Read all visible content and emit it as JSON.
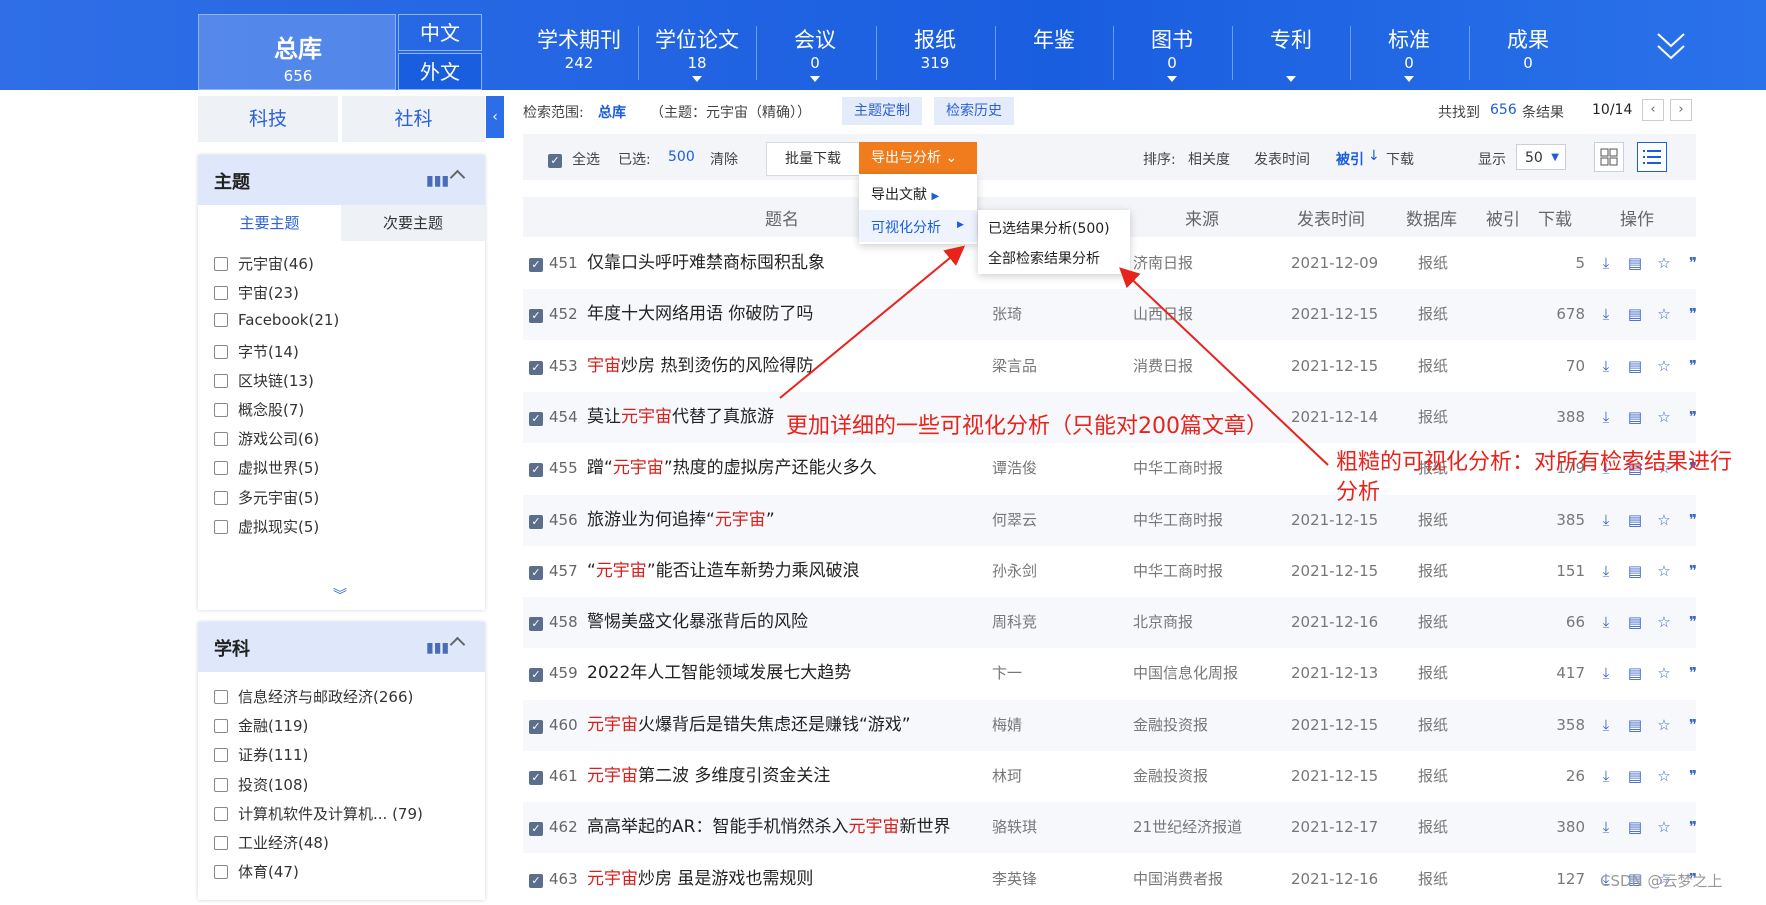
{
  "top_nav": {
    "all_title": "总库",
    "all_count": "656",
    "lang_cn": "中文",
    "lang_en": "外文",
    "items": [
      {
        "label": "学术期刊",
        "count": "242",
        "caret": false
      },
      {
        "label": "学位论文",
        "count": "18",
        "caret": true
      },
      {
        "label": "会议",
        "count": "0",
        "caret": true
      },
      {
        "label": "报纸",
        "count": "319",
        "caret": false
      },
      {
        "label": "年鉴",
        "count": "",
        "caret": false
      },
      {
        "label": "图书",
        "count": "0",
        "caret": true
      },
      {
        "label": "专利",
        "count": "",
        "caret": true
      },
      {
        "label": "标准",
        "count": "0",
        "caret": true
      },
      {
        "label": "成果",
        "count": "0",
        "caret": false
      }
    ]
  },
  "left": {
    "tabs": [
      "科技",
      "社科"
    ],
    "topic": {
      "title": "主题",
      "subtabs": [
        "主要主题",
        "次要主题"
      ],
      "items": [
        "元宇宙(46)",
        "宇宙(23)",
        "Facebook(21)",
        "字节(14)",
        "区块链(13)",
        "概念股(7)",
        "游戏公司(6)",
        "虚拟世界(5)",
        "多元宇宙(5)",
        "虚拟现实(5)"
      ]
    },
    "subject": {
      "title": "学科",
      "items": [
        "信息经济与邮政经济(266)",
        "金融(119)",
        "证券(111)",
        "投资(108)",
        "计算机软件及计算机...  (79)",
        "工业经济(48)",
        "体育(47)"
      ]
    }
  },
  "search": {
    "scope_label": "检索范围:",
    "scope_value": "总库",
    "query": "（主题：元宇宙（精确））",
    "btn_custom": "主题定制",
    "btn_history": "检索历史",
    "found_prefix": "共找到",
    "found_count": "656",
    "found_suffix": "条结果",
    "page": "10/14"
  },
  "toolbar": {
    "select_all": "全选",
    "selected_label": "已选:",
    "selected_count": "500",
    "clear": "清除",
    "batch_download": "批量下载",
    "export": "导出与分析",
    "sort_label": "排序:",
    "sort_relevance": "相关度",
    "sort_date": "发表时间",
    "sort_cited": "被引",
    "sort_download": "下载",
    "display_label": "显示",
    "display_value": "50"
  },
  "dropdown": {
    "export_docs": "导出文献",
    "visual_analysis": "可视化分析",
    "selected_analysis": "已选结果分析(500)",
    "all_analysis": "全部检索结果分析"
  },
  "table": {
    "headers": {
      "title": "题名",
      "author": "作者",
      "source": "来源",
      "date": "发表时间",
      "db": "数据库",
      "cited": "被引",
      "download": "下载",
      "ops": "操作"
    },
    "rows": [
      {
        "num": "451",
        "title": [
          {
            "t": "仅靠口头呼吁难禁商标囤积乱象",
            "h": false
          }
        ],
        "author": "",
        "source": "济南日报",
        "date": "2021-12-09",
        "db": "报纸",
        "downloads": "5"
      },
      {
        "num": "452",
        "title": [
          {
            "t": "年度十大网络用语 你破防了吗",
            "h": false
          }
        ],
        "author": "张琦",
        "source": "山西日报",
        "date": "2021-12-15",
        "db": "报纸",
        "downloads": "678"
      },
      {
        "num": "453",
        "title": [
          {
            "t": "宇宙",
            "h": true
          },
          {
            "t": "炒房 热到烫伤的风险得防",
            "h": false
          }
        ],
        "author": "梁言品",
        "source": "消费日报",
        "date": "2021-12-15",
        "db": "报纸",
        "downloads": "70"
      },
      {
        "num": "454",
        "title": [
          {
            "t": "莫让",
            "h": false
          },
          {
            "t": "元宇宙",
            "h": true
          },
          {
            "t": "代替了真旅游",
            "h": false
          }
        ],
        "author": "",
        "source": "",
        "date": "2021-12-14",
        "db": "报纸",
        "downloads": "388"
      },
      {
        "num": "455",
        "title": [
          {
            "t": "蹭“",
            "h": false
          },
          {
            "t": "元宇宙",
            "h": true
          },
          {
            "t": "”热度的虚拟房产还能火多久",
            "h": false
          }
        ],
        "author": "谭浩俊",
        "source": "中华工商时报",
        "date": "",
        "db": "报纸",
        "downloads": "179"
      },
      {
        "num": "456",
        "title": [
          {
            "t": "旅游业为何追捧“",
            "h": false
          },
          {
            "t": "元宇宙",
            "h": true
          },
          {
            "t": "”",
            "h": false
          }
        ],
        "author": "何翠云",
        "source": "中华工商时报",
        "date": "2021-12-15",
        "db": "报纸",
        "downloads": "385"
      },
      {
        "num": "457",
        "title": [
          {
            "t": "“",
            "h": false
          },
          {
            "t": "元宇宙",
            "h": true
          },
          {
            "t": "”能否让造车新势力乘风破浪",
            "h": false
          }
        ],
        "author": "孙永剑",
        "source": "中华工商时报",
        "date": "2021-12-15",
        "db": "报纸",
        "downloads": "151"
      },
      {
        "num": "458",
        "title": [
          {
            "t": "警惕美盛文化暴涨背后的风险",
            "h": false
          }
        ],
        "author": "周科竞",
        "source": "北京商报",
        "date": "2021-12-16",
        "db": "报纸",
        "downloads": "66"
      },
      {
        "num": "459",
        "title": [
          {
            "t": "2022年人工智能领域发展七大趋势",
            "h": false
          }
        ],
        "author": "卞一",
        "source": "中国信息化周报",
        "date": "2021-12-13",
        "db": "报纸",
        "downloads": "417"
      },
      {
        "num": "460",
        "title": [
          {
            "t": "元宇宙",
            "h": true
          },
          {
            "t": "火爆背后是错失焦虑还是赚钱“游戏”",
            "h": false
          }
        ],
        "author": "梅婧",
        "source": "金融投资报",
        "date": "2021-12-15",
        "db": "报纸",
        "downloads": "358"
      },
      {
        "num": "461",
        "title": [
          {
            "t": "元宇宙",
            "h": true
          },
          {
            "t": "第二波 多维度引资金关注",
            "h": false
          }
        ],
        "author": "林珂",
        "source": "金融投资报",
        "date": "2021-12-15",
        "db": "报纸",
        "downloads": "26"
      },
      {
        "num": "462",
        "title": [
          {
            "t": "高高举起的AR：智能手机悄然杀入",
            "h": false
          },
          {
            "t": "元宇宙",
            "h": true
          },
          {
            "t": "新世界",
            "h": false
          }
        ],
        "author": "骆轶琪",
        "source": "21世纪经济报道",
        "date": "2021-12-17",
        "db": "报纸",
        "downloads": "380"
      },
      {
        "num": "463",
        "title": [
          {
            "t": "元宇宙",
            "h": true
          },
          {
            "t": "炒房 虽是游戏也需规则",
            "h": false
          }
        ],
        "author": "李英锋",
        "source": "中国消费者报",
        "date": "2021-12-16",
        "db": "报纸",
        "downloads": "127"
      }
    ]
  },
  "annotations": {
    "a1": "更加详细的一些可视化分析（只能对200篇文章）",
    "a2_line1": "粗糙的可视化分析：对所有检索结果进行",
    "a2_line2": "分析"
  },
  "watermark": "CSDN @云梦之上",
  "colors": {
    "accent": "#1a5ee0",
    "orange": "#f07c1e",
    "highlight": "#d9201c",
    "annotation": "#e8231c"
  }
}
